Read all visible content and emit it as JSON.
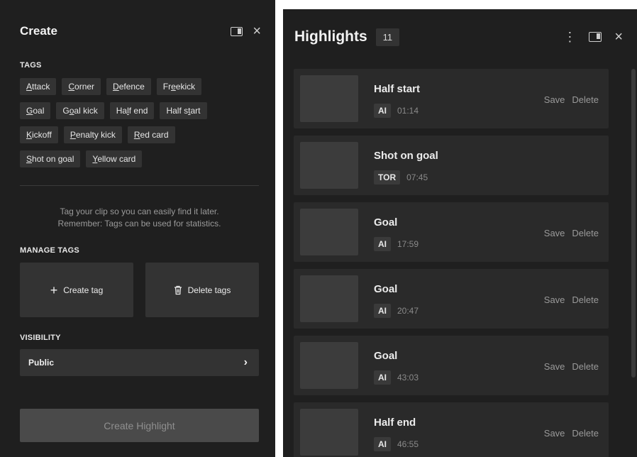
{
  "create": {
    "title": "Create",
    "tags_label": "TAGS",
    "tag_rows": [
      [
        {
          "pre": "",
          "u": "A",
          "post": "ttack"
        },
        {
          "pre": "",
          "u": "C",
          "post": "orner"
        },
        {
          "pre": "",
          "u": "D",
          "post": "efence"
        },
        {
          "pre": "Fr",
          "u": "e",
          "post": "ekick"
        }
      ],
      [
        {
          "pre": "",
          "u": "G",
          "post": "oal"
        },
        {
          "pre": "G",
          "u": "o",
          "post": "al kick"
        },
        {
          "pre": "Ha",
          "u": "l",
          "post": "f end"
        },
        {
          "pre": "Half s",
          "u": "t",
          "post": "art"
        }
      ],
      [
        {
          "pre": "",
          "u": "K",
          "post": "ickoff"
        },
        {
          "pre": "",
          "u": "P",
          "post": "enalty kick"
        },
        {
          "pre": "",
          "u": "R",
          "post": "ed card"
        }
      ],
      [
        {
          "pre": "",
          "u": "S",
          "post": "hot on goal"
        },
        {
          "pre": "",
          "u": "Y",
          "post": "ellow card"
        }
      ]
    ],
    "help_line1": "Tag your clip so you can easily find it later.",
    "help_line2": "Remember: Tags can be used for statistics.",
    "manage_label": "MANAGE TAGS",
    "create_tag_label": "Create tag",
    "delete_tags_label": "Delete tags",
    "visibility_label": "VISIBILITY",
    "visibility_value": "Public",
    "create_highlight_label": "Create Highlight"
  },
  "highlights": {
    "title": "Highlights",
    "count": "11",
    "items": [
      {
        "name": "Half start",
        "source": "AI",
        "time": "01:14",
        "actions": true
      },
      {
        "name": "Shot on goal",
        "source": "TOR",
        "time": "07:45",
        "actions": false
      },
      {
        "name": "Goal",
        "source": "AI",
        "time": "17:59",
        "actions": true
      },
      {
        "name": "Goal",
        "source": "AI",
        "time": "20:47",
        "actions": true
      },
      {
        "name": "Goal",
        "source": "AI",
        "time": "43:03",
        "actions": true
      },
      {
        "name": "Half end",
        "source": "AI",
        "time": "46:55",
        "actions": true
      }
    ],
    "save_label": "Save",
    "delete_label": "Delete"
  },
  "icons": {
    "panel_toggle": "panel-toggle-icon",
    "close": "close-icon",
    "more": "more-vertical-icon",
    "plus": "plus-icon",
    "trash": "trash-icon",
    "chevron": "chevron-right-icon"
  }
}
